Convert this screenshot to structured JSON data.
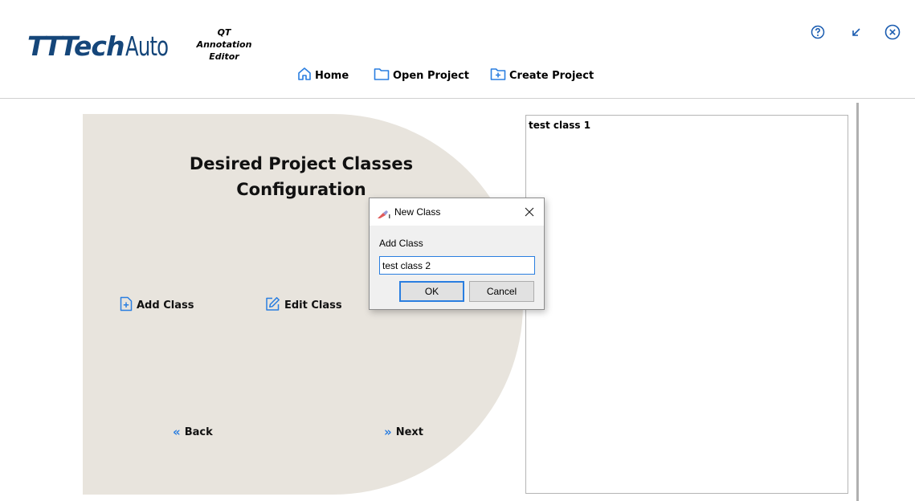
{
  "header": {
    "logo": {
      "part1": "TT",
      "part2": "Tech",
      "part3": "Auto"
    },
    "subtitle": {
      "line1": "QT",
      "line2": "Annotation",
      "line3": "Editor"
    },
    "nav": [
      {
        "label": "Home",
        "icon": "home-icon"
      },
      {
        "label": "Open Project",
        "icon": "folder-icon"
      },
      {
        "label": "Create Project",
        "icon": "folder-plus-icon"
      }
    ],
    "window_controls": [
      "help-icon",
      "minimize-icon",
      "close-icon"
    ]
  },
  "main": {
    "title_line1": "Desired Project Classes",
    "title_line2": "Configuration",
    "add_class_label": "Add Class",
    "edit_class_label": "Edit Class",
    "back_label": "Back",
    "next_label": "Next",
    "back_glyph": "«",
    "next_glyph": "»"
  },
  "class_list": {
    "items": [
      "test class 1"
    ]
  },
  "dialog": {
    "title": "New Class",
    "label": "Add Class",
    "input_value": "test class 2",
    "ok_label": "OK",
    "cancel_label": "Cancel"
  },
  "colors": {
    "brand": "#15467a",
    "panel_bg": "#e8e4dd",
    "accent": "#2a7ee0"
  }
}
